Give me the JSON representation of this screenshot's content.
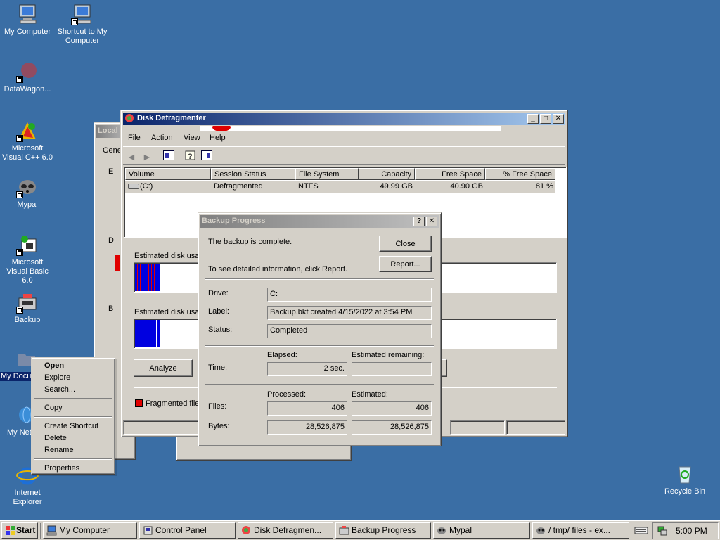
{
  "desktop": {
    "icons": [
      {
        "label": "My Computer"
      },
      {
        "label": "Shortcut to My Computer"
      },
      {
        "label": "DataWagon..."
      },
      {
        "label": "Microsoft Visual C++ 6.0"
      },
      {
        "label": "Mypal"
      },
      {
        "label": "Microsoft Visual Basic 6.0"
      },
      {
        "label": "Backup"
      },
      {
        "label": "My Docu"
      },
      {
        "label": "My Net Plac"
      },
      {
        "label": "Internet Explorer"
      },
      {
        "label": "Recycle Bin"
      }
    ]
  },
  "context_menu": {
    "items": [
      "Open",
      "Explore",
      "Search...",
      "Copy",
      "Create Shortcut",
      "Delete",
      "Rename",
      "Properties"
    ]
  },
  "local_window": {
    "title": "Local",
    "tab": "Gene",
    "groups": [
      "E",
      "D",
      "B"
    ]
  },
  "defrag": {
    "title": "Disk Defragmenter",
    "menu": [
      "File",
      "Action",
      "View",
      "Help"
    ],
    "columns": [
      "Volume",
      "Session Status",
      "File System",
      "Capacity",
      "Free Space",
      "% Free Space"
    ],
    "row": {
      "volume": "(C:)",
      "status": "Defragmented",
      "fs": "NTFS",
      "capacity": "49.99 GB",
      "free": "40.90 GB",
      "pct": "81 %"
    },
    "before_label": "Estimated disk usag",
    "after_label": "Estimated disk usag",
    "analyze": "Analyze",
    "legend_fragmented": "Fragmented file"
  },
  "backup": {
    "title": "Backup Progress",
    "complete_msg": "The backup is complete.",
    "report_msg": "To see detailed information, click Report.",
    "close_btn": "Close",
    "report_btn": "Report...",
    "drive_label": "Drive:",
    "drive_value": "C:",
    "label_label": "Label:",
    "label_value": "Backup.bkf created 4/15/2022 at 3:54 PM",
    "status_label": "Status:",
    "status_value": "Completed",
    "time_label": "Time:",
    "elapsed_label": "Elapsed:",
    "elapsed_value": "2 sec.",
    "remaining_label": "Estimated remaining:",
    "remaining_value": "",
    "processed_label": "Processed:",
    "estimated_label": "Estimated:",
    "files_label": "Files:",
    "files_processed": "406",
    "files_estimated": "406",
    "bytes_label": "Bytes:",
    "bytes_processed": "28,526,875",
    "bytes_estimated": "28,526,875"
  },
  "taskbar": {
    "start": "Start",
    "tasks": [
      "My Computer",
      "Control Panel",
      "Disk Defragmen...",
      "Backup Progress",
      "Mypal",
      "/ tmp/ files - ex..."
    ],
    "clock": "5:00 PM"
  },
  "colors": {
    "desktop": "#3a6ea5",
    "titlebar_active": "#0a246a",
    "fragmented": "#e00000",
    "contiguous": "#0000e0"
  }
}
